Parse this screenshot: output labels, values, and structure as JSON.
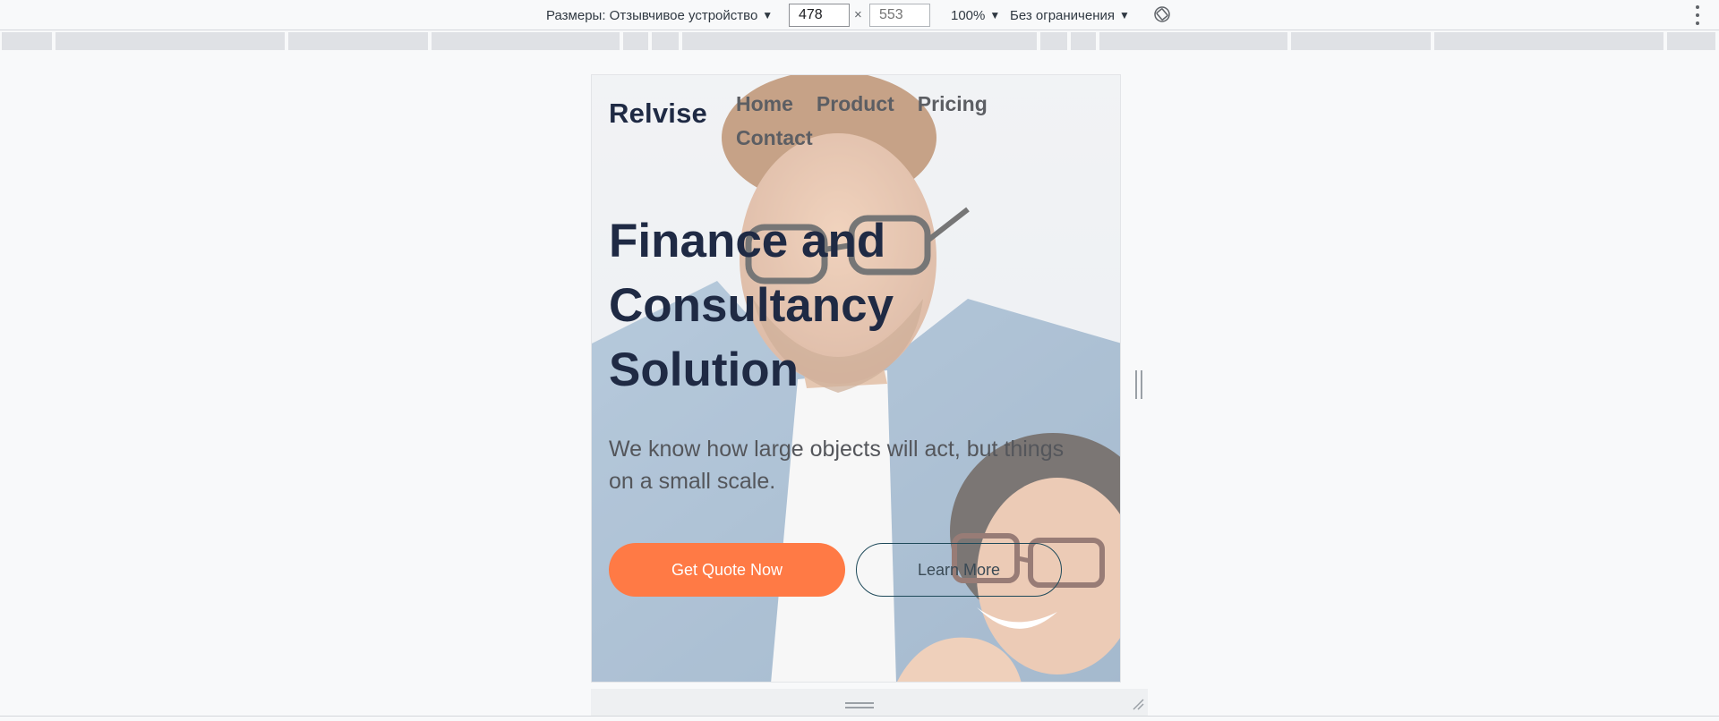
{
  "devtools": {
    "dimensions_label": "Размеры: Отзывчивое устройство",
    "width_value": "478",
    "height_placeholder": "553",
    "times_symbol": "×",
    "zoom": "100%",
    "throttling": "Без ограничения",
    "caret": "▼",
    "icons": [
      "rotate-icon",
      "more-vert-icon"
    ]
  },
  "page": {
    "brand": "Relvise",
    "nav": [
      {
        "label": "Home"
      },
      {
        "label": "Product"
      },
      {
        "label": "Pricing"
      },
      {
        "label": "Contact"
      }
    ],
    "hero": {
      "title_lines": [
        "Finance and",
        "Consultancy",
        "Solution"
      ],
      "subtitle": "We know how large objects will act, but things on a small scale."
    },
    "buttons": {
      "primary": "Get Quote Now",
      "secondary": "Learn More"
    }
  },
  "colors": {
    "brand_dark": "#1f2a44",
    "accent_orange": "#ff7a45",
    "outline_teal": "#1f4a5a"
  }
}
